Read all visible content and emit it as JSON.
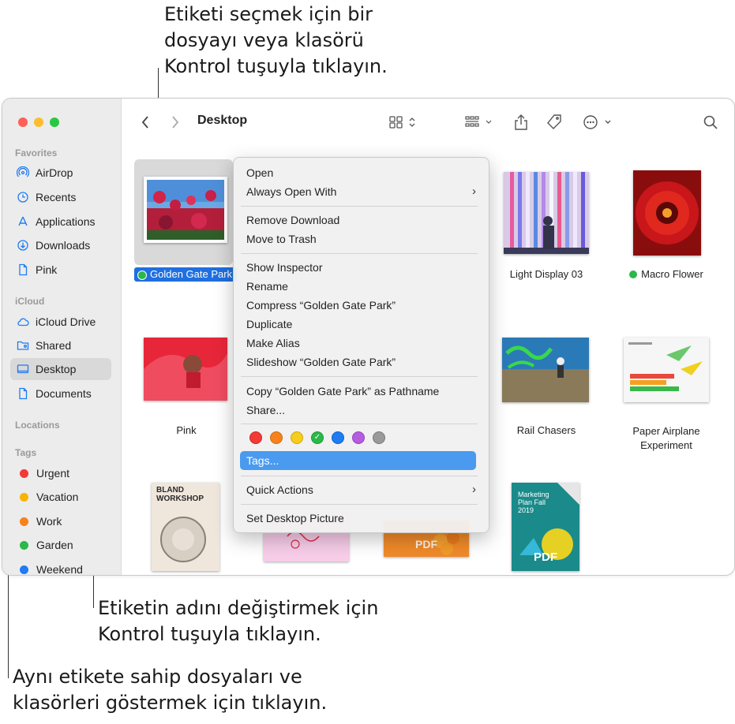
{
  "callouts": {
    "top": [
      "Etiketi seçmek için bir",
      "dosyayı veya klasörü",
      "Kontrol tuşuyla tıklayın."
    ],
    "middle": [
      "Etiketin adını değiştirmek için",
      "Kontrol tuşuyla tıklayın."
    ],
    "bottom": [
      "Aynı etikete sahip dosyaları ve",
      "klasörleri göstermek için tıklayın."
    ]
  },
  "window": {
    "title": "Desktop"
  },
  "sidebar": {
    "favorites_header": "Favorites",
    "favorites": [
      {
        "label": "AirDrop",
        "icon": "airdrop-icon"
      },
      {
        "label": "Recents",
        "icon": "clock-icon"
      },
      {
        "label": "Applications",
        "icon": "applications-icon"
      },
      {
        "label": "Downloads",
        "icon": "download-icon"
      },
      {
        "label": "Pink",
        "icon": "document-icon"
      }
    ],
    "icloud_header": "iCloud",
    "icloud": [
      {
        "label": "iCloud Drive",
        "icon": "cloud-icon"
      },
      {
        "label": "Shared",
        "icon": "shared-folder-icon"
      },
      {
        "label": "Desktop",
        "icon": "desktop-icon"
      },
      {
        "label": "Documents",
        "icon": "document-icon"
      }
    ],
    "locations_header": "Locations",
    "tags_header": "Tags",
    "tags": [
      {
        "label": "Urgent",
        "color": "#f23a36"
      },
      {
        "label": "Vacation",
        "color": "#f7b500"
      },
      {
        "label": "Work",
        "color": "#f7821b"
      },
      {
        "label": "Garden",
        "color": "#2bb84a"
      },
      {
        "label": "Weekend",
        "color": "#1f7cf2"
      }
    ]
  },
  "files": {
    "golden_gate": {
      "name": "Golden Gate Park",
      "tag_color": "#2bb84a"
    },
    "light_display": {
      "name": "Light Display 03"
    },
    "macro_flower": {
      "name": "Macro Flower",
      "tag_color": "#2bb84a"
    },
    "pink": {
      "name": "Pink"
    },
    "rail_chasers": {
      "name": "Rail Chasers"
    },
    "paper_airplane": {
      "name": "Paper Airplane Experiment"
    },
    "bland_workshop": {
      "title": "BLAND WORKSHOP"
    },
    "pdf_badge": "PDF",
    "marketing_plan": {
      "text": "Marketing Plan Fall 2019",
      "badge": "PDF"
    }
  },
  "context_menu": {
    "open": "Open",
    "always_open_with": "Always Open With",
    "remove_download": "Remove Download",
    "move_to_trash": "Move to Trash",
    "show_inspector": "Show Inspector",
    "rename": "Rename",
    "compress": "Compress “Golden Gate Park”",
    "duplicate": "Duplicate",
    "make_alias": "Make Alias",
    "slideshow": "Slideshow “Golden Gate Park”",
    "copy_pathname": "Copy “Golden Gate Park” as Pathname",
    "share": "Share...",
    "tag_colors": [
      "#f23a36",
      "#f7821b",
      "#f7cc1b",
      "#2bb84a",
      "#1f7cf2",
      "#b65ce0",
      "#9a9a9a"
    ],
    "tags": "Tags...",
    "quick_actions": "Quick Actions",
    "set_desktop_picture": "Set Desktop Picture"
  }
}
